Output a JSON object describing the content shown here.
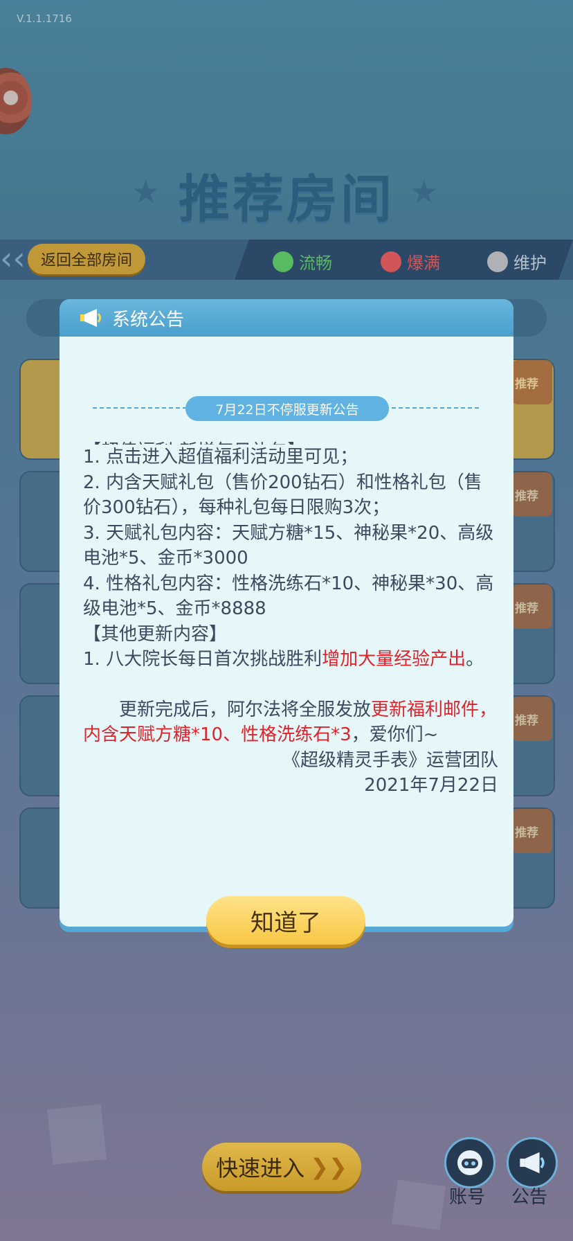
{
  "version": "V.1.1.1716",
  "page_title": "推荐房间",
  "back_all_rooms": "返回全部房间",
  "statuses": [
    {
      "label": "流畅",
      "color": "#5fcc63"
    },
    {
      "label": "爆满",
      "color": "#e85b5b"
    },
    {
      "label": "维护",
      "color": "#c2c2c2"
    }
  ],
  "room_badge": "推荐",
  "dialog": {
    "title": "系统公告",
    "banner": "7月22日不停服更新公告",
    "cut_line": "【超值福利-新增每日礼包】",
    "line1": "1. 点击进入超值福利活动里可见；",
    "line2": "2. 内含天赋礼包（售价200钻石）和性格礼包（售价300钻石），每种礼包每日限购3次；",
    "line3": "3. 天赋礼包内容：天赋方糖*15、神秘果*20、高级电池*5、金币*3000",
    "line4": "4. 性格礼包内容：性格洗练石*10、神秘果*30、高级电池*5、金币*8888",
    "section2": "【其他更新内容】",
    "line5_a": "1. 八大院长每日首次挑战胜利",
    "line5_red": "增加大量经验产出",
    "line5_end": "。",
    "para_a": "更新完成后，阿尔法将全服发放",
    "para_red": "更新福利邮件，内含天赋方糖*10、性格洗练石*3",
    "para_end": "，爱你们~",
    "signature": "《超级精灵手表》运营团队",
    "date": "2021年7月22日",
    "ok_label": "知道了"
  },
  "quick_enter": "快速进入",
  "quick_enter_icon": "double-chevron-right",
  "account_label": "账号",
  "notice_label": "公告",
  "colors": {
    "accent": "#5fb2e2",
    "dialog_bg": "#e6f7f9",
    "highlight_red": "#e0232b",
    "button_yellow": "#f7c744"
  }
}
